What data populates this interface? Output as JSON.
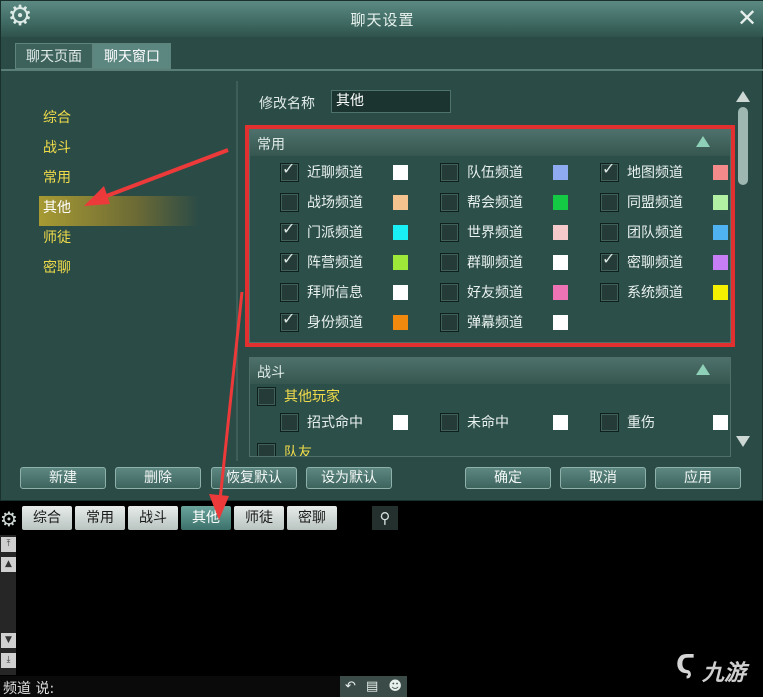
{
  "window": {
    "title": "聊天设置",
    "tabs": [
      "聊天页面",
      "聊天窗口"
    ]
  },
  "nav": [
    "综合",
    "战斗",
    "常用",
    "其他",
    "师徒",
    "密聊"
  ],
  "name": {
    "label": "修改名称",
    "value": "其他"
  },
  "group1": {
    "title": "常用",
    "rows": [
      [
        {
          "label": "近聊频道",
          "checked": true,
          "color": "#ffffff"
        },
        {
          "label": "队伍频道",
          "checked": false,
          "color": "#8eaaf0"
        },
        {
          "label": "地图频道",
          "checked": true,
          "color": "#f58a8a"
        }
      ],
      [
        {
          "label": "战场频道",
          "checked": false,
          "color": "#f5c48e"
        },
        {
          "label": "帮会频道",
          "checked": false,
          "color": "#14c944"
        },
        {
          "label": "同盟频道",
          "checked": false,
          "color": "#b2f0a4"
        }
      ],
      [
        {
          "label": "门派频道",
          "checked": true,
          "color": "#18f0f5"
        },
        {
          "label": "世界频道",
          "checked": false,
          "color": "#f6caca"
        },
        {
          "label": "团队频道",
          "checked": false,
          "color": "#4eb3f0"
        }
      ],
      [
        {
          "label": "阵营频道",
          "checked": true,
          "color": "#9ee83a"
        },
        {
          "label": "群聊频道",
          "checked": false,
          "color": "#ffffff"
        },
        {
          "label": "密聊频道",
          "checked": true,
          "color": "#c77ef5"
        }
      ],
      [
        {
          "label": "拜师信息",
          "checked": false,
          "color": "#ffffff"
        },
        {
          "label": "好友频道",
          "checked": false,
          "color": "#ee73b4"
        },
        {
          "label": "系统频道",
          "checked": false,
          "color": "#f5f000"
        }
      ],
      [
        {
          "label": "身份频道",
          "checked": true,
          "color": "#f2890f"
        },
        {
          "label": "弹幕频道",
          "checked": false,
          "color": "#ffffff"
        }
      ]
    ]
  },
  "group2": {
    "title": "战斗",
    "sub1": "其他玩家",
    "sub1_items": [
      {
        "label": "招式命中",
        "color": "#ffffff"
      },
      {
        "label": "未命中",
        "color": "#ffffff"
      },
      {
        "label": "重伤",
        "color": "#ffffff"
      }
    ],
    "sub2": "队友"
  },
  "buttons": {
    "new": "新建",
    "delete": "删除",
    "restore": "恢复默认",
    "setdefault": "设为默认",
    "ok": "确定",
    "cancel": "取消",
    "apply": "应用"
  },
  "chat": {
    "tabs": [
      "综合",
      "常用",
      "战斗",
      "其他",
      "师徒",
      "密聊"
    ],
    "active": 3,
    "input_label": "频道 说:"
  },
  "watermark": "九游",
  "accent": "#e23030"
}
